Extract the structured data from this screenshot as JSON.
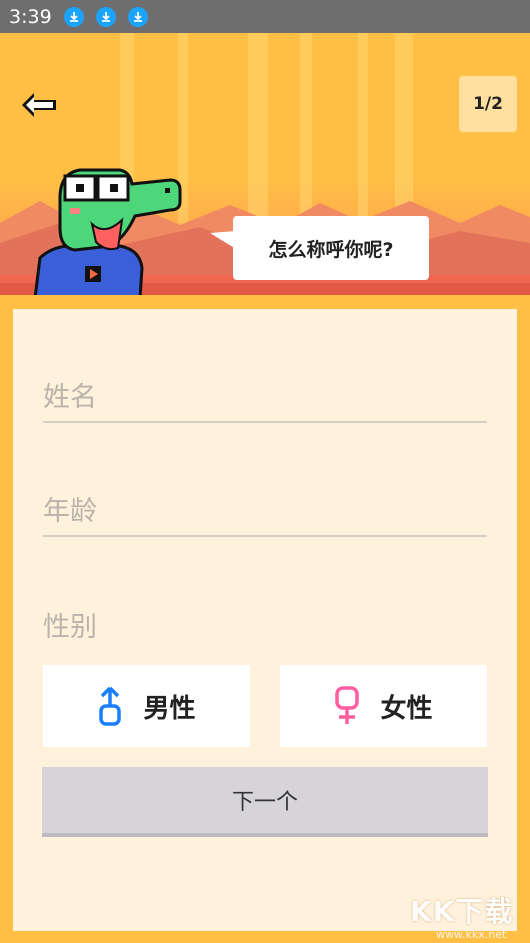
{
  "status_bar": {
    "time": "3:39",
    "download_icon_count": 3
  },
  "header": {
    "page_indicator": "1/2",
    "speech_bubble": "怎么称呼你呢?"
  },
  "form": {
    "name_placeholder": "姓名",
    "age_placeholder": "年龄",
    "gender_label": "性别",
    "male_label": "男性",
    "female_label": "女性",
    "next_label": "下一个"
  },
  "watermark": {
    "text": "KK下载",
    "url": "www.kkx.net"
  },
  "colors": {
    "background": "#ffbf45",
    "card": "#fff2dd",
    "male_icon": "#1a7fff",
    "female_icon": "#ff5fa0",
    "next_button": "#d6d4d8"
  }
}
